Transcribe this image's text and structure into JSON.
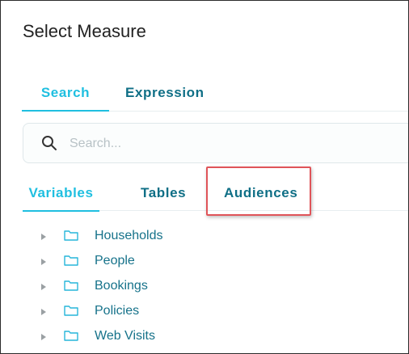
{
  "dialog": {
    "title": "Select Measure"
  },
  "mode_tabs": [
    {
      "label": "Search",
      "active": true
    },
    {
      "label": "Expression",
      "active": false
    }
  ],
  "search": {
    "placeholder": "Search...",
    "value": ""
  },
  "category_tabs": [
    {
      "label": "Variables",
      "active": true
    },
    {
      "label": "Tables",
      "active": false
    },
    {
      "label": "Audiences",
      "active": false,
      "highlighted": true
    }
  ],
  "tree": {
    "items": [
      {
        "label": "Households",
        "icon": "folder-icon"
      },
      {
        "label": "People",
        "icon": "folder-icon"
      },
      {
        "label": "Bookings",
        "icon": "folder-icon"
      },
      {
        "label": "Policies",
        "icon": "folder-icon"
      },
      {
        "label": "Web Visits",
        "icon": "folder-icon"
      }
    ]
  },
  "colors": {
    "accent": "#1fbfe0",
    "tab_inactive": "#0f6f86",
    "tree_text": "#16728a",
    "highlight_box": "#e05459"
  }
}
